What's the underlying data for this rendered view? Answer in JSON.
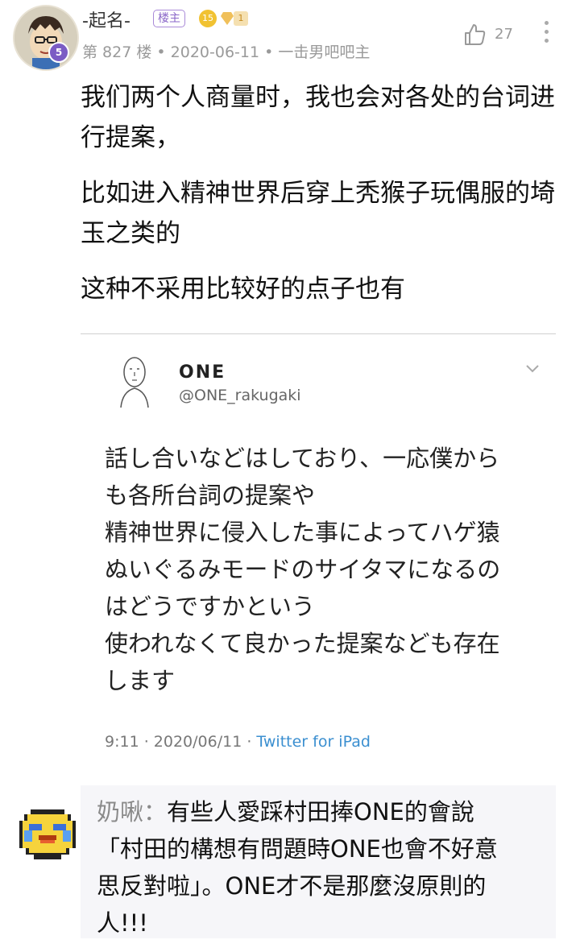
{
  "post": {
    "username": "-起名-",
    "host_badge": "楼主",
    "level_badge": "15",
    "small_badge": "1",
    "avatar_level": "5",
    "floor": "第 827 楼",
    "sep1": "•",
    "date": "2020-06-11",
    "sep2": "•",
    "forum": "一击男吧吧主",
    "like_count": "27",
    "paragraphs": [
      "我们两个人商量时，我也会对各处的台词进行提案，",
      "比如进入精神世界后穿上秃猴子玩偶服的埼玉之类的",
      "这种不采用比较好的点子也有"
    ]
  },
  "tweet": {
    "name": "ONE",
    "handle": "@ONE_rakugaki",
    "lines": [
      "話し合いなどはしており、一応僕から",
      "も各所台詞の提案や",
      "精神世界に侵入した事によってハゲ猿",
      "ぬいぐるみモードのサイタマになるの",
      "はどうですかという",
      "使われなくて良かった提案なども存在",
      "します"
    ],
    "time": "9:11 · 2020/06/11 ·",
    "source": "Twitter for iPad"
  },
  "comment": {
    "author": "奶啾：",
    "lines": [
      "有些人愛踩村田捧ONE的會說",
      "「村田的構想有問題時ONE也會不好意",
      "思反對啦」。ONE才不是那麼沒原則的",
      "人!!!"
    ]
  },
  "colors": {
    "host_badge": "#8a66c8",
    "link": "#3b8fd0",
    "meta": "#9a9a9a",
    "comment_bg": "#f6f6f9"
  },
  "icons": [
    "avatar",
    "thumbs-up-icon",
    "more-vertical-icon",
    "chevron-down-icon",
    "crying-emoji-icon",
    "gem-icon"
  ]
}
